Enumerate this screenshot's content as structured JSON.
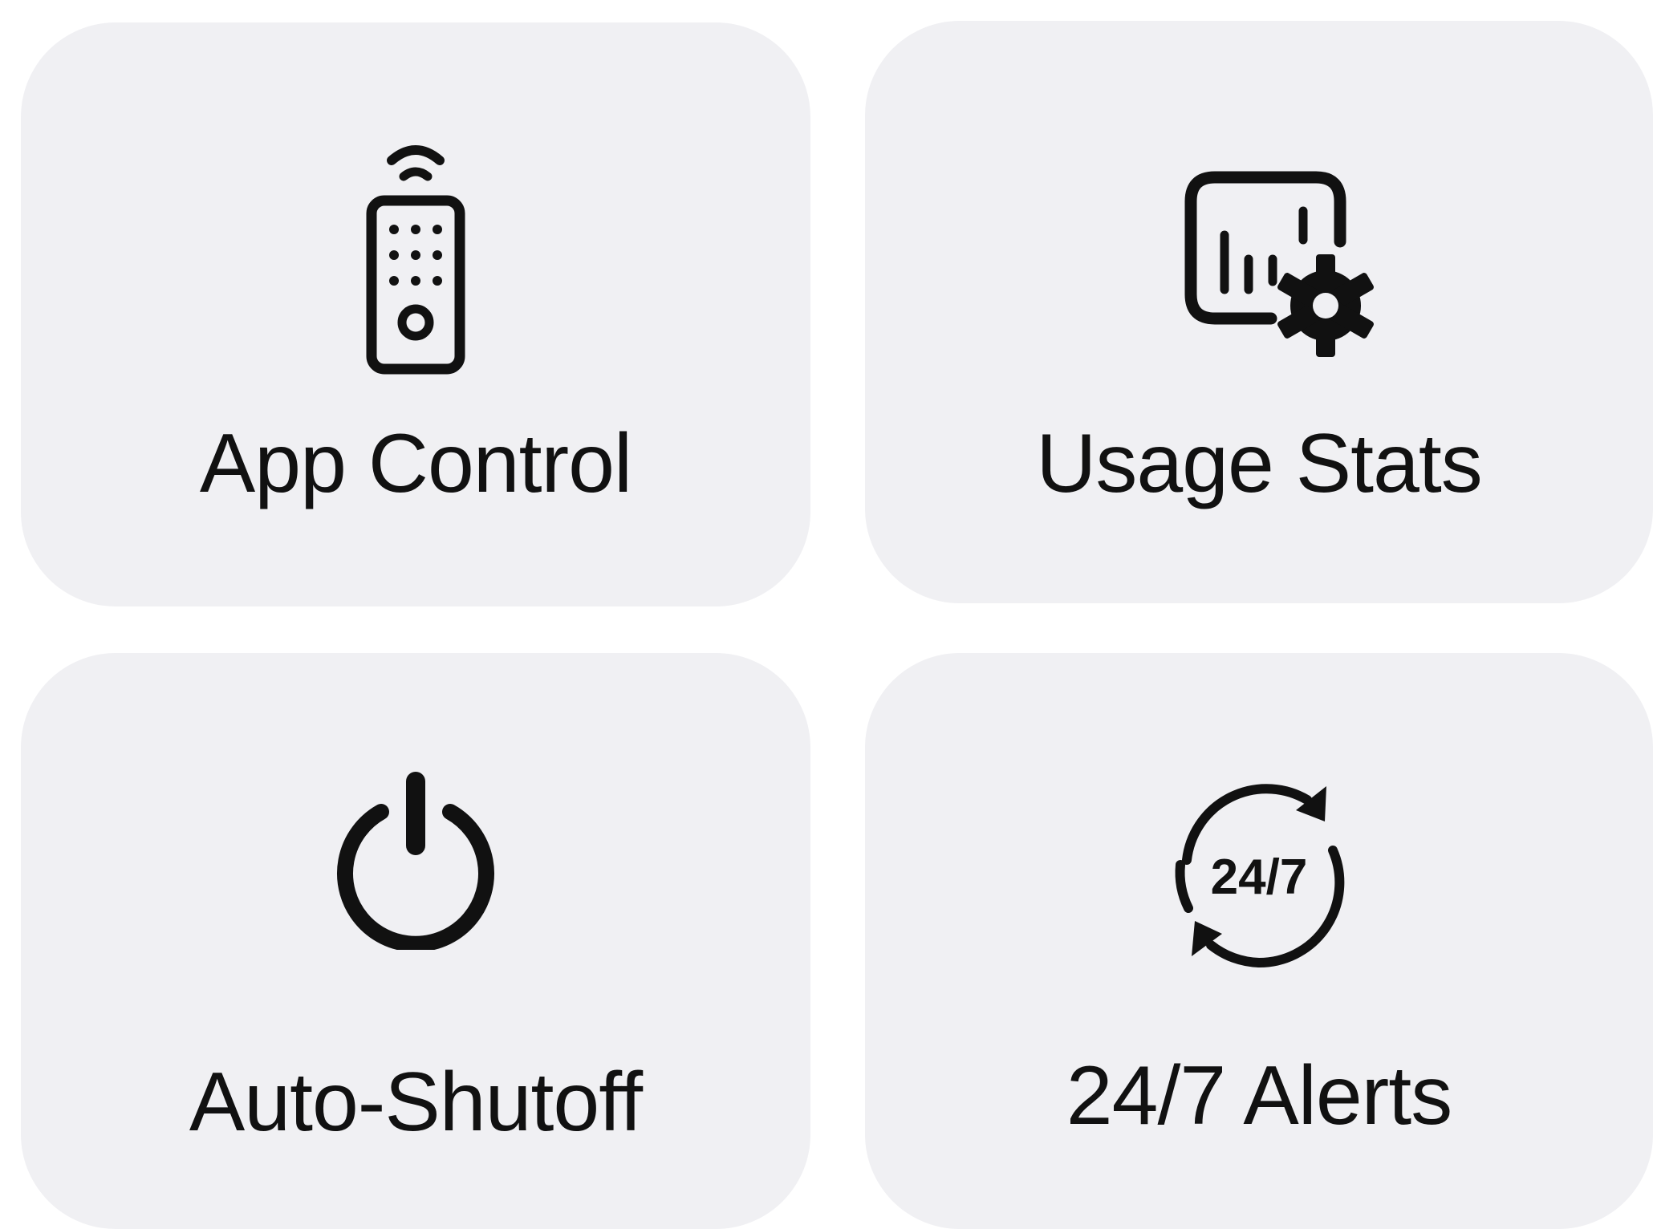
{
  "features": [
    {
      "id": "app-control",
      "label": "App Control",
      "icon": "remote-control-icon"
    },
    {
      "id": "usage-stats",
      "label": "Usage Stats",
      "icon": "chart-settings-icon"
    },
    {
      "id": "auto-shutoff",
      "label": "Auto-Shutoff",
      "icon": "power-icon"
    },
    {
      "id": "alerts",
      "label": "24/7 Alerts",
      "icon": "24-7-cycle-icon",
      "icon_text": "24/7"
    }
  ],
  "colors": {
    "card_background": "#f0f0f3",
    "icon": "#111111",
    "text": "#111111",
    "page_background": "#ffffff"
  }
}
